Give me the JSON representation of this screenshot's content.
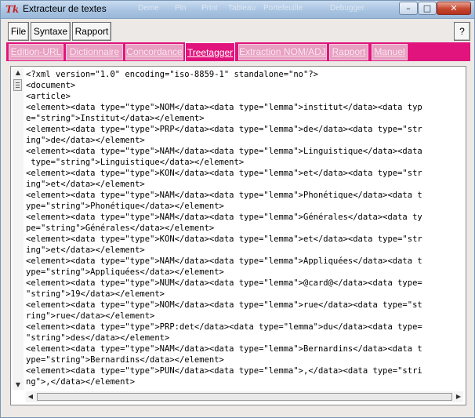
{
  "window": {
    "title": "Extracteur de textes",
    "background_ghost_labels": [
      "Deme",
      "Pin",
      "Print",
      "Tableau",
      "Portefeuille",
      "Debugger"
    ],
    "accent_color": "#e0147c"
  },
  "menu": {
    "items": [
      {
        "label": "File"
      },
      {
        "label": "Syntaxe"
      },
      {
        "label": "Rapport"
      }
    ],
    "help_label": "?"
  },
  "tabs": [
    {
      "label": "Edition-URL",
      "active": false
    },
    {
      "label": "Dictionnaire",
      "active": false
    },
    {
      "label": "Concordance",
      "active": false
    },
    {
      "label": "Treetagger",
      "active": true
    },
    {
      "label": "Extraction NOM/ADJ",
      "active": false
    },
    {
      "label": "Rapport",
      "active": false
    },
    {
      "label": "Manuel",
      "active": false
    }
  ],
  "editor": {
    "lines": [
      "<?xml version=\"1.0\" encoding=\"iso-8859-1\" standalone=\"no\"?>",
      "<document>",
      "<article>",
      "<element><data type=\"type\">NOM</data><data type=\"lemma\">institut</data><data typ",
      "e=\"string\">Institut</data></element>",
      "<element><data type=\"type\">PRP</data><data type=\"lemma\">de</data><data type=\"str",
      "ing\">de</data></element>",
      "<element><data type=\"type\">NAM</data><data type=\"lemma\">Linguistique</data><data",
      " type=\"string\">Linguistique</data></element>",
      "<element><data type=\"type\">KON</data><data type=\"lemma\">et</data><data type=\"str",
      "ing\">et</data></element>",
      "<element><data type=\"type\">NAM</data><data type=\"lemma\">Phonétique</data><data t",
      "ype=\"string\">Phonétique</data></element>",
      "<element><data type=\"type\">NAM</data><data type=\"lemma\">Générales</data><data ty",
      "pe=\"string\">Générales</data></element>",
      "<element><data type=\"type\">KON</data><data type=\"lemma\">et</data><data type=\"str",
      "ing\">et</data></element>",
      "<element><data type=\"type\">NAM</data><data type=\"lemma\">Appliquées</data><data t",
      "ype=\"string\">Appliquées</data></element>",
      "<element><data type=\"type\">NUM</data><data type=\"lemma\">@card@</data><data type=",
      "\"string\">19</data></element>",
      "<element><data type=\"type\">NOM</data><data type=\"lemma\">rue</data><data type=\"st",
      "ring\">rue</data></element>",
      "<element><data type=\"type\">PRP:det</data><data type=\"lemma\">du</data><data type=",
      "\"string\">des</data></element>",
      "<element><data type=\"type\">NAM</data><data type=\"lemma\">Bernardins</data><data t",
      "ype=\"string\">Bernardins</data></element>",
      "<element><data type=\"type\">PUN</data><data type=\"lemma\">,</data><data type=\"stri",
      "ng\">,</data></element>",
      "<element><data type=\"type\">NUM</data><data type=\"lemma\">@card@</data><data type="
    ]
  },
  "scrollbar": {
    "up_arrow": "▲",
    "down_arrow": "▼",
    "left_arrow": "◀",
    "right_arrow": "▶"
  },
  "icons": {
    "app": "Tk",
    "minimize": "–",
    "maximize": "□",
    "close": "✕"
  }
}
